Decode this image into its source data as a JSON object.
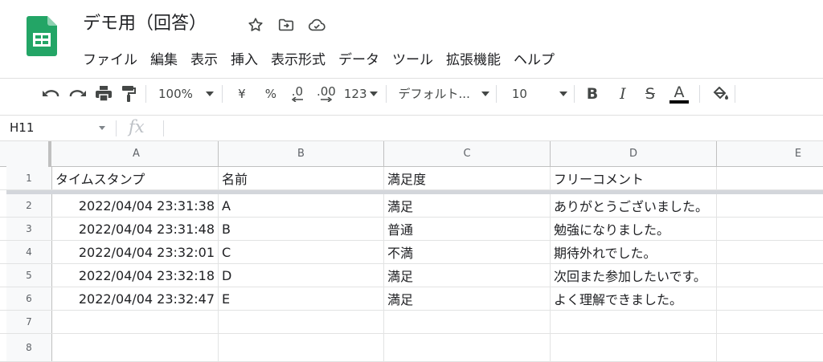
{
  "app": {
    "doc_title": "デモ用（回答）",
    "brand_color": "#23a566",
    "icons": [
      "star-icon",
      "move-to-folder-icon",
      "cloud-saved-icon"
    ]
  },
  "menu": [
    "ファイル",
    "編集",
    "表示",
    "挿入",
    "表示形式",
    "データ",
    "ツール",
    "拡張機能",
    "ヘルプ"
  ],
  "toolbar": {
    "zoom": "100%",
    "currency": "¥",
    "percent": "%",
    "decrease_decimal": ".0",
    "increase_decimal": ".00",
    "more_formats": "123",
    "font": "デフォルト...",
    "font_size": "10",
    "bold": "B",
    "italic": "I",
    "strike": "S",
    "text_color": "A"
  },
  "formula_bar": {
    "cell_ref": "H11",
    "fx": "fx",
    "value": ""
  },
  "sheet": {
    "columns": [
      "A",
      "B",
      "C",
      "D",
      "E"
    ],
    "row_numbers": [
      "1",
      "2",
      "3",
      "4",
      "5",
      "6",
      "7",
      "8"
    ],
    "rows": [
      [
        "タイムスタンプ",
        "名前",
        "満足度",
        "フリーコメント"
      ],
      [
        "2022/04/04 23:31:38",
        "A",
        "満足",
        "ありがとうございました。"
      ],
      [
        "2022/04/04 23:31:48",
        "B",
        "普通",
        "勉強になりました。"
      ],
      [
        "2022/04/04 23:32:01",
        "C",
        "不満",
        "期待外れでした。"
      ],
      [
        "2022/04/04 23:32:18",
        "D",
        "満足",
        "次回また参加したいです。"
      ],
      [
        "2022/04/04 23:32:47",
        "E",
        "満足",
        "よく理解できました。"
      ],
      [
        "",
        "",
        "",
        ""
      ],
      [
        "",
        "",
        "",
        ""
      ]
    ]
  }
}
